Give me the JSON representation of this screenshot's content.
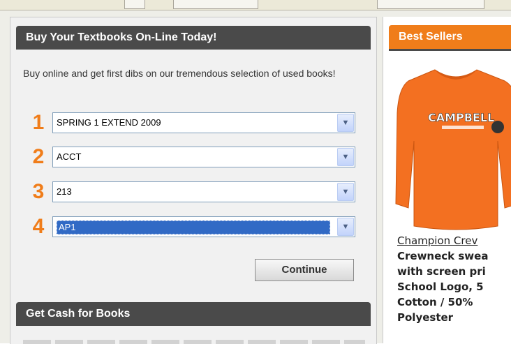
{
  "buy_panel": {
    "title": "Buy Your Textbooks On-Line Today!",
    "intro": "Buy online and get first dibs on our tremendous selection of used books!",
    "steps": [
      {
        "number": "1",
        "value": "SPRING 1 EXTEND 2009"
      },
      {
        "number": "2",
        "value": "ACCT"
      },
      {
        "number": "3",
        "value": "213"
      },
      {
        "number": "4",
        "value": "AP1"
      }
    ],
    "continue_label": "Continue"
  },
  "cash_panel": {
    "title": "Get Cash for Books"
  },
  "best_sellers": {
    "title": "Best Sellers",
    "shirt_logo_text": "CAMPBELL",
    "product_name": "Champion Crev",
    "product_desc_lines": [
      "Crewneck swea",
      "with screen pri",
      "School Logo, 5",
      "Cotton / 50%",
      "Polyester"
    ]
  },
  "colors": {
    "accent_orange": "#f07d1a",
    "header_dark": "#4a4a4a",
    "selection_blue": "#316ac5"
  },
  "icons": {
    "dropdown_arrow": "chevron-down-icon"
  }
}
